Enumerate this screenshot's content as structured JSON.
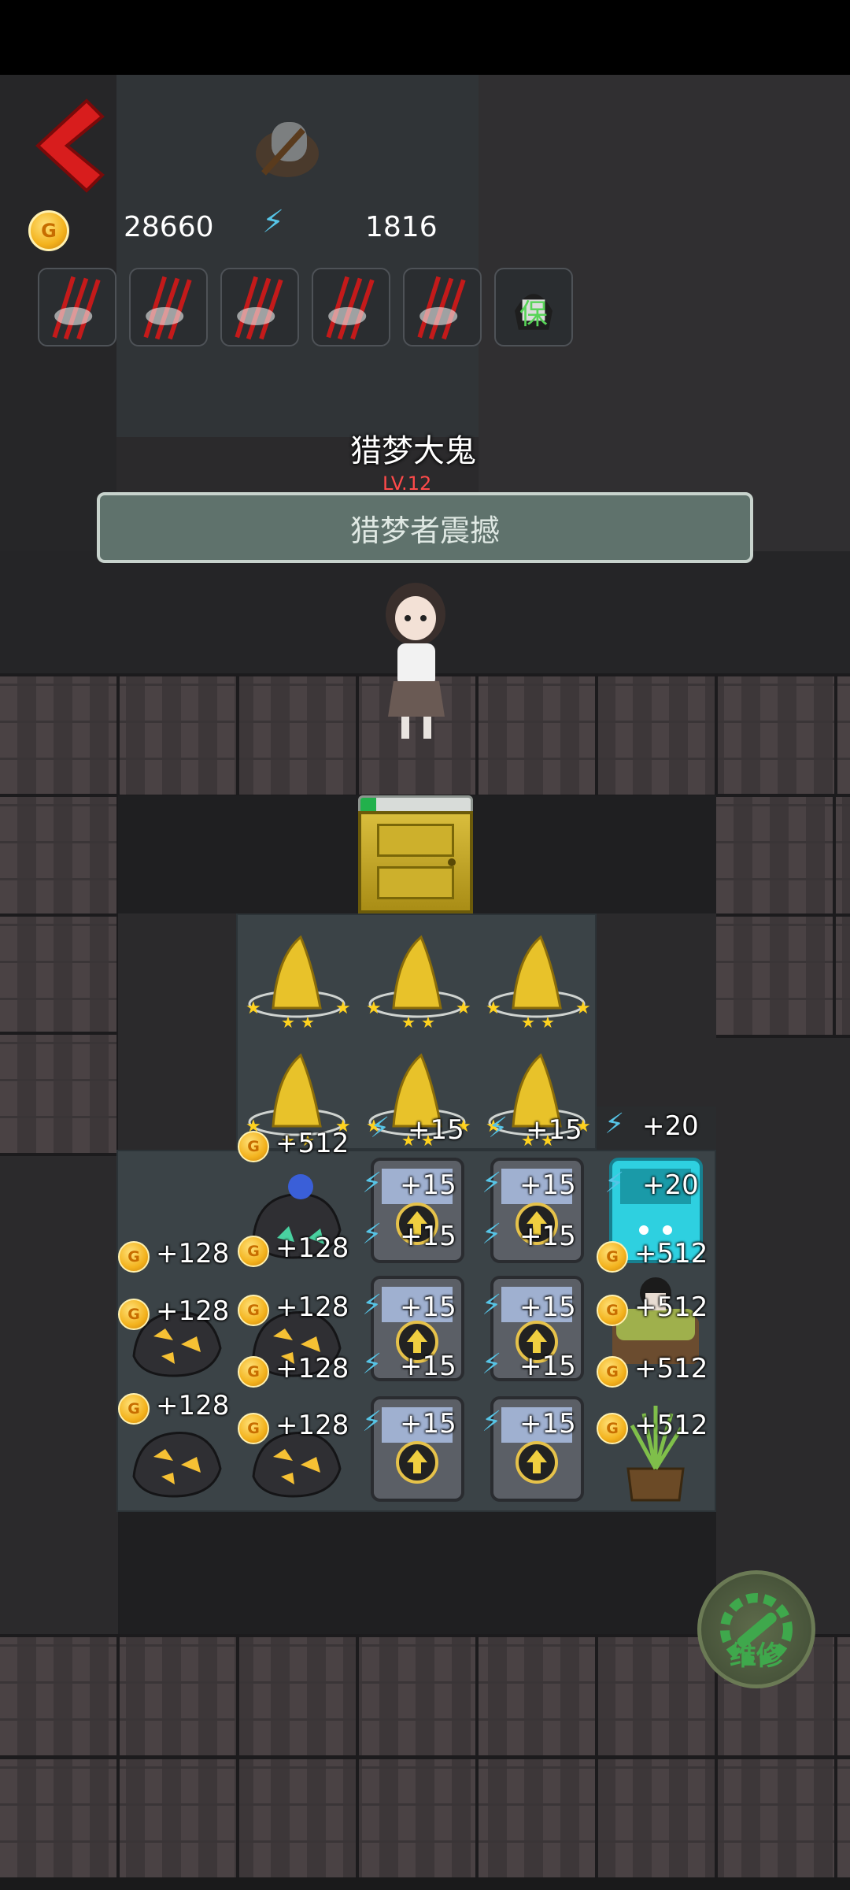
{
  "header": {
    "gold_value": "28660",
    "energy_value": "1816",
    "coin_glyph": "G"
  },
  "slots": [
    {
      "icon": "claw-slash-icon"
    },
    {
      "icon": "claw-slash-icon"
    },
    {
      "icon": "claw-slash-icon"
    },
    {
      "icon": "claw-slash-icon"
    },
    {
      "icon": "claw-slash-icon"
    },
    {
      "icon": "ghost-avatar-icon",
      "glyph": "保"
    }
  ],
  "ghost": {
    "name": "猎梦大鬼",
    "level": "LV.12"
  },
  "banner": "猎梦者震撼",
  "door": {
    "progress": 0.14
  },
  "grid_labels": {
    "coin_512": "+512",
    "coin_128": "+128",
    "energy_15": "+15",
    "energy_20": "+20"
  },
  "repair_button": {
    "label": "维修"
  },
  "colors": {
    "energy": "#56c4e6",
    "gold": "#f3b21d",
    "banner": "#5f726c",
    "progress_fill": "#22b14c"
  }
}
